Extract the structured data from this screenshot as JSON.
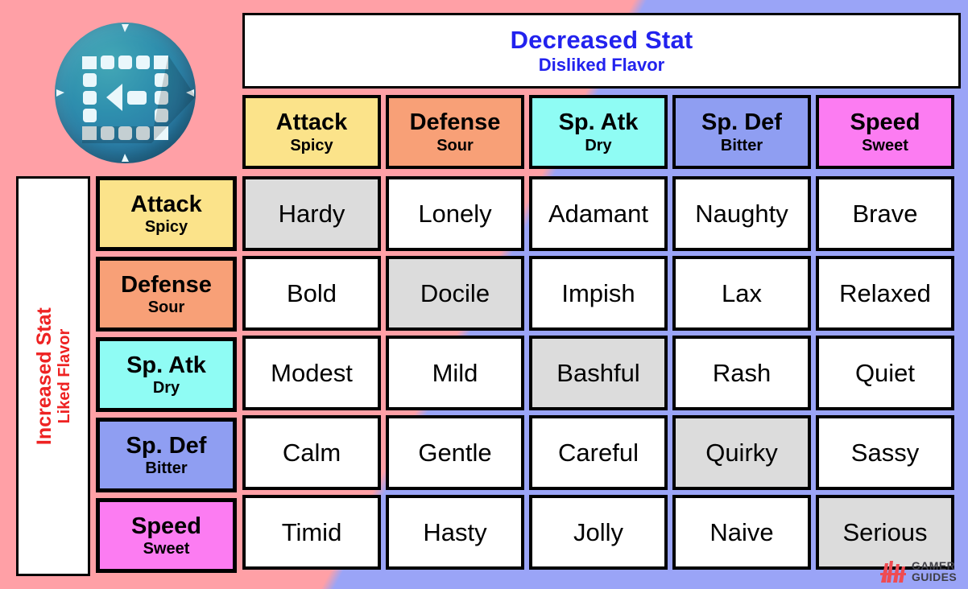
{
  "logo": {
    "icon": "gamer-guides-sphere-logo"
  },
  "title_banner": {
    "line1": "Decreased Stat",
    "line2": "Disliked Flavor",
    "color": "#2222ee"
  },
  "row_axis": {
    "line1": "Increased Stat",
    "line2": "Liked Flavor",
    "color": "#ee2222"
  },
  "columns": [
    {
      "stat": "Attack",
      "flavor": "Spicy",
      "color": "#fbe38a"
    },
    {
      "stat": "Defense",
      "flavor": "Sour",
      "color": "#f8a077"
    },
    {
      "stat": "Sp. Atk",
      "flavor": "Dry",
      "color": "#8ffcf4"
    },
    {
      "stat": "Sp. Def",
      "flavor": "Bitter",
      "color": "#8f9ef2"
    },
    {
      "stat": "Speed",
      "flavor": "Sweet",
      "color": "#fc7cf2"
    }
  ],
  "rows": [
    {
      "stat": "Attack",
      "flavor": "Spicy",
      "color": "#fbe38a"
    },
    {
      "stat": "Defense",
      "flavor": "Sour",
      "color": "#f8a077"
    },
    {
      "stat": "Sp. Atk",
      "flavor": "Dry",
      "color": "#8ffcf4"
    },
    {
      "stat": "Sp. Def",
      "flavor": "Bitter",
      "color": "#8f9ef2"
    },
    {
      "stat": "Speed",
      "flavor": "Sweet",
      "color": "#fc7cf2"
    }
  ],
  "matrix": [
    [
      {
        "name": "Hardy",
        "neutral": true
      },
      {
        "name": "Lonely",
        "neutral": false
      },
      {
        "name": "Adamant",
        "neutral": false
      },
      {
        "name": "Naughty",
        "neutral": false
      },
      {
        "name": "Brave",
        "neutral": false
      }
    ],
    [
      {
        "name": "Bold",
        "neutral": false
      },
      {
        "name": "Docile",
        "neutral": true
      },
      {
        "name": "Impish",
        "neutral": false
      },
      {
        "name": "Lax",
        "neutral": false
      },
      {
        "name": "Relaxed",
        "neutral": false
      }
    ],
    [
      {
        "name": "Modest",
        "neutral": false
      },
      {
        "name": "Mild",
        "neutral": false
      },
      {
        "name": "Bashful",
        "neutral": true
      },
      {
        "name": "Rash",
        "neutral": false
      },
      {
        "name": "Quiet",
        "neutral": false
      }
    ],
    [
      {
        "name": "Calm",
        "neutral": false
      },
      {
        "name": "Gentle",
        "neutral": false
      },
      {
        "name": "Careful",
        "neutral": false
      },
      {
        "name": "Quirky",
        "neutral": true
      },
      {
        "name": "Sassy",
        "neutral": false
      }
    ],
    [
      {
        "name": "Timid",
        "neutral": false
      },
      {
        "name": "Hasty",
        "neutral": false
      },
      {
        "name": "Jolly",
        "neutral": false
      },
      {
        "name": "Naive",
        "neutral": false
      },
      {
        "name": "Serious",
        "neutral": true
      }
    ]
  ],
  "watermark": {
    "line1": "GAMER",
    "line2": "GUIDES",
    "icon": "gamer-guides-mark-icon",
    "color": "#ef4b52"
  },
  "background": {
    "upper_right": "#9aa4f7",
    "lower_left": "#ffa0a6"
  }
}
